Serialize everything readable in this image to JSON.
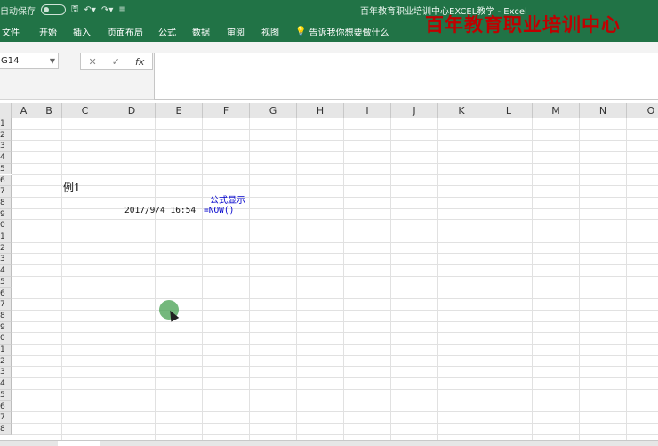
{
  "titlebar": {
    "autosave_label": "自动保存",
    "autosave_state": "关",
    "window_title": "百年教育职业培训中心EXCEL教学  -  Excel"
  },
  "ribbon": {
    "tabs": [
      "文件",
      "开始",
      "插入",
      "页面布局",
      "公式",
      "数据",
      "审阅",
      "视图"
    ],
    "tell_me": "告诉我你想要做什么",
    "watermark": "百年教育职业培训中心"
  },
  "formula_bar": {
    "name_box": "G14",
    "cancel_glyph": "✕",
    "enter_glyph": "✓",
    "fx_glyph": "fx",
    "content": ""
  },
  "grid": {
    "columns": [
      "A",
      "B",
      "C",
      "D",
      "E",
      "F",
      "G",
      "H",
      "I",
      "J",
      "K",
      "L",
      "M",
      "N",
      "O"
    ],
    "rows": [
      "1",
      "2",
      "3",
      "4",
      "5",
      "6",
      "7",
      "8",
      "9",
      "10",
      "11",
      "12",
      "13",
      "14",
      "15",
      "16",
      "17",
      "18",
      "19",
      "20",
      "21",
      "22",
      "23",
      "24",
      "25",
      "26",
      "27",
      "28"
    ],
    "cells": {
      "C6": "例1",
      "F7": "公式显示",
      "D8": "2017/9/4 16:54",
      "F8": "=NOW()"
    }
  },
  "colors": {
    "brand_green": "#217346",
    "watermark_red": "#c00000",
    "formula_blue": "#0000cc"
  }
}
